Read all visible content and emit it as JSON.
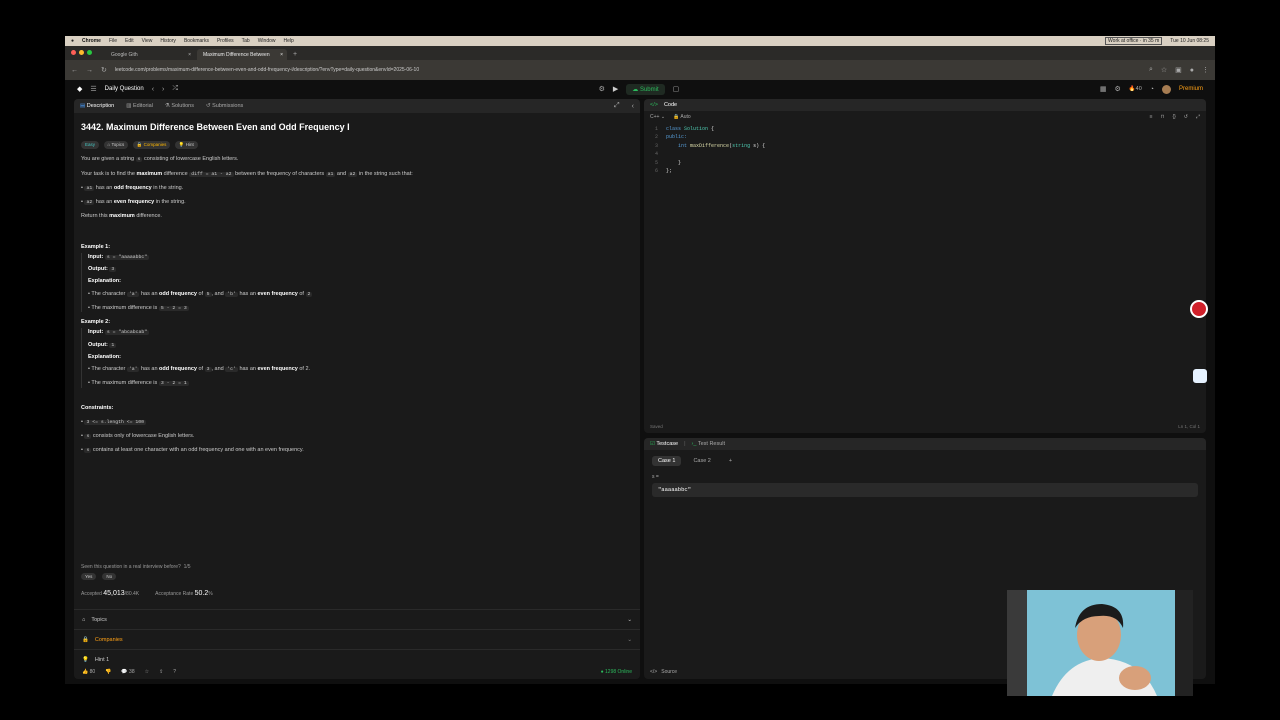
{
  "macbar": {
    "items": [
      "Chrome",
      "File",
      "Edit",
      "View",
      "History",
      "Bookmarks",
      "Profiles",
      "Tab",
      "Window",
      "Help"
    ],
    "status": "Work at office · in 35 m",
    "clock": "Tue 10 Jun 08:25"
  },
  "browser": {
    "tabs": [
      {
        "label": "Google Gith"
      },
      {
        "label": "Maximum Difference Between"
      }
    ],
    "url": "leetcode.com/problems/maximum-difference-between-even-and-odd-frequency-i/description/?envType=daily-question&envId=2025-06-10"
  },
  "lcnav": {
    "daily": "Daily Question",
    "submit": "Submit",
    "streak": "40",
    "premium": "Premium"
  },
  "left": {
    "tabs": [
      "Description",
      "Editorial",
      "Solutions",
      "Submissions"
    ],
    "title": "3442. Maximum Difference Between Even and Odd Frequency I",
    "tags": [
      "Easy",
      "Topics",
      "Companies",
      "Hint"
    ],
    "intro_a": "You are given a string",
    "intro_code": "s",
    "intro_b": "consisting of lowercase English letters.",
    "task_a": "Your task is to find the",
    "task_bold": "maximum",
    "task_b": "difference",
    "task_code": "diff = a1 - a2",
    "task_c": "between the frequency of characters",
    "task_code2": "a1",
    "task_d": "and",
    "task_code3": "a2",
    "task_e": "in the string such that:",
    "cond1_code": "a1",
    "cond1_a": "has an",
    "cond1_bold": "odd frequency",
    "cond1_b": "in the string.",
    "cond2_code": "a2",
    "cond2_a": "has an",
    "cond2_bold": "even frequency",
    "cond2_b": "in the string.",
    "ret_a": "Return this",
    "ret_bold": "maximum",
    "ret_b": "difference.",
    "ex1": {
      "title": "Example 1:",
      "input_lbl": "Input:",
      "input": "s = \"aaaaabbc\"",
      "output_lbl": "Output:",
      "output": "3",
      "expl_lbl": "Explanation:",
      "b1_a": "The character",
      "b1_c1": "'a'",
      "b1_b": "has an",
      "b1_bold": "odd frequency",
      "b1_c": "of",
      "b1_c2": "5",
      "b1_d": ", and",
      "b1_c3": "'b'",
      "b1_e": "has an",
      "b1_bold2": "even frequency",
      "b1_f": "of",
      "b1_c4": "2",
      "b2_a": "The maximum difference is",
      "b2_code": "5 - 2 = 3"
    },
    "ex2": {
      "title": "Example 2:",
      "input_lbl": "Input:",
      "input": "s = \"abcabcab\"",
      "output_lbl": "Output:",
      "output": "1",
      "expl_lbl": "Explanation:",
      "b1_a": "The character",
      "b1_c1": "'a'",
      "b1_b": "has an",
      "b1_bold": "odd frequency",
      "b1_c": "of",
      "b1_c2": "3",
      "b1_d": ", and",
      "b1_c3": "'c'",
      "b1_e": "has an",
      "b1_bold2": "even frequency",
      "b1_f": "of 2.",
      "b2_a": "The maximum difference is",
      "b2_code": "3 - 2 = 1"
    },
    "constraints_title": "Constraints:",
    "c1": "3 <= s.length <= 100",
    "c2_code": "s",
    "c2": "consists only of lowercase English letters.",
    "c3_code": "s",
    "c3": "contains at least one character with an odd frequency and one with an even frequency.",
    "seen": "Seen this question in a real interview before?",
    "seen_count": "1/5",
    "yes": "Yes",
    "no": "No",
    "accepted_lbl": "Accepted",
    "accepted": "45,013",
    "accepted_suffix": "/80.4K",
    "rate_lbl": "Acceptance Rate",
    "rate": "50.2",
    "rate_suffix": "%",
    "acc_topics": "Topics",
    "acc_companies": "Companies",
    "acc_hint": "Hint 1",
    "likes": "80",
    "comments": "38",
    "online": "1298 Online"
  },
  "code": {
    "title": "Code",
    "lang": "C++",
    "auto": "Auto",
    "lines": [
      [
        "1",
        "class Solution {"
      ],
      [
        "2",
        "public:"
      ],
      [
        "3",
        "    int maxDifference(string s) {"
      ],
      [
        "4",
        ""
      ],
      [
        "5",
        "    }"
      ],
      [
        "6",
        "};"
      ]
    ],
    "saved": "Saved",
    "pos": "Ln 1, Col 1"
  },
  "test": {
    "tab1": "Testcase",
    "tab2": "Test Result",
    "case1": "Case 1",
    "case2": "Case 2",
    "var": "s =",
    "value": "\"aaaaabbc\"",
    "source": "Source"
  },
  "colors": {
    "accent": "#ffa116",
    "easy": "#46c6c2",
    "submit": "#2cbb5d"
  }
}
